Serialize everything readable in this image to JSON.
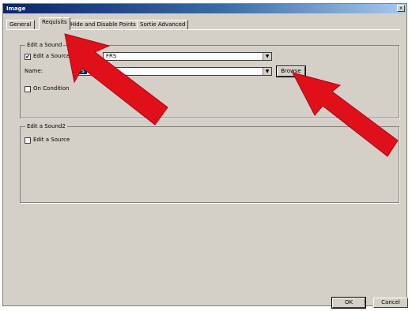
{
  "window": {
    "title": "Image",
    "close_glyph": "x"
  },
  "tabs": [
    "General",
    "Requisits",
    "Hide and Disable Points",
    "Sortie Advanced"
  ],
  "group1": {
    "legend": "Edit a Sound",
    "source_checkbox": {
      "checked": true,
      "check_glyph": "✔",
      "label": "Edit a Source"
    },
    "source_combo": {
      "value": "FRS"
    },
    "name_label": "Name:",
    "name_combo": {
      "value": "s"
    },
    "browse_label": "Browse",
    "condition_checkbox": {
      "checked": false,
      "label": "On Condition"
    }
  },
  "group2": {
    "legend": "Edit a Sound2",
    "source_checkbox": {
      "checked": false,
      "label": "Edit a Source"
    }
  },
  "footer": {
    "ok_label": "OK",
    "cancel_label": "Cancel"
  },
  "annotations": {
    "arrow_color": "#e0101a"
  },
  "icons": {
    "dropdown": "▼"
  }
}
